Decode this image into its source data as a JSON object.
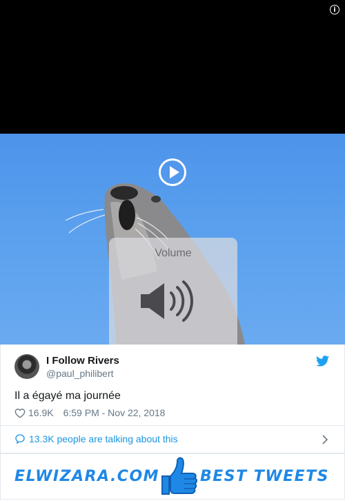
{
  "video": {
    "volume_label": "Volume",
    "icons": [
      "info-icon",
      "play-icon",
      "speaker-icon"
    ]
  },
  "tweet": {
    "author_name": "I Follow Rivers",
    "author_handle": "@paul_philibert",
    "text": "Il a égayé ma journée",
    "likes": "16.9K",
    "timestamp": "6:59 PM - Nov 22, 2018",
    "talking": "13.3K people are talking about this",
    "accent": "#1b95e0"
  },
  "banner": {
    "left": "ELWIZARA.COM",
    "right": "BEST TWEETS",
    "color": "#1f88e6"
  }
}
